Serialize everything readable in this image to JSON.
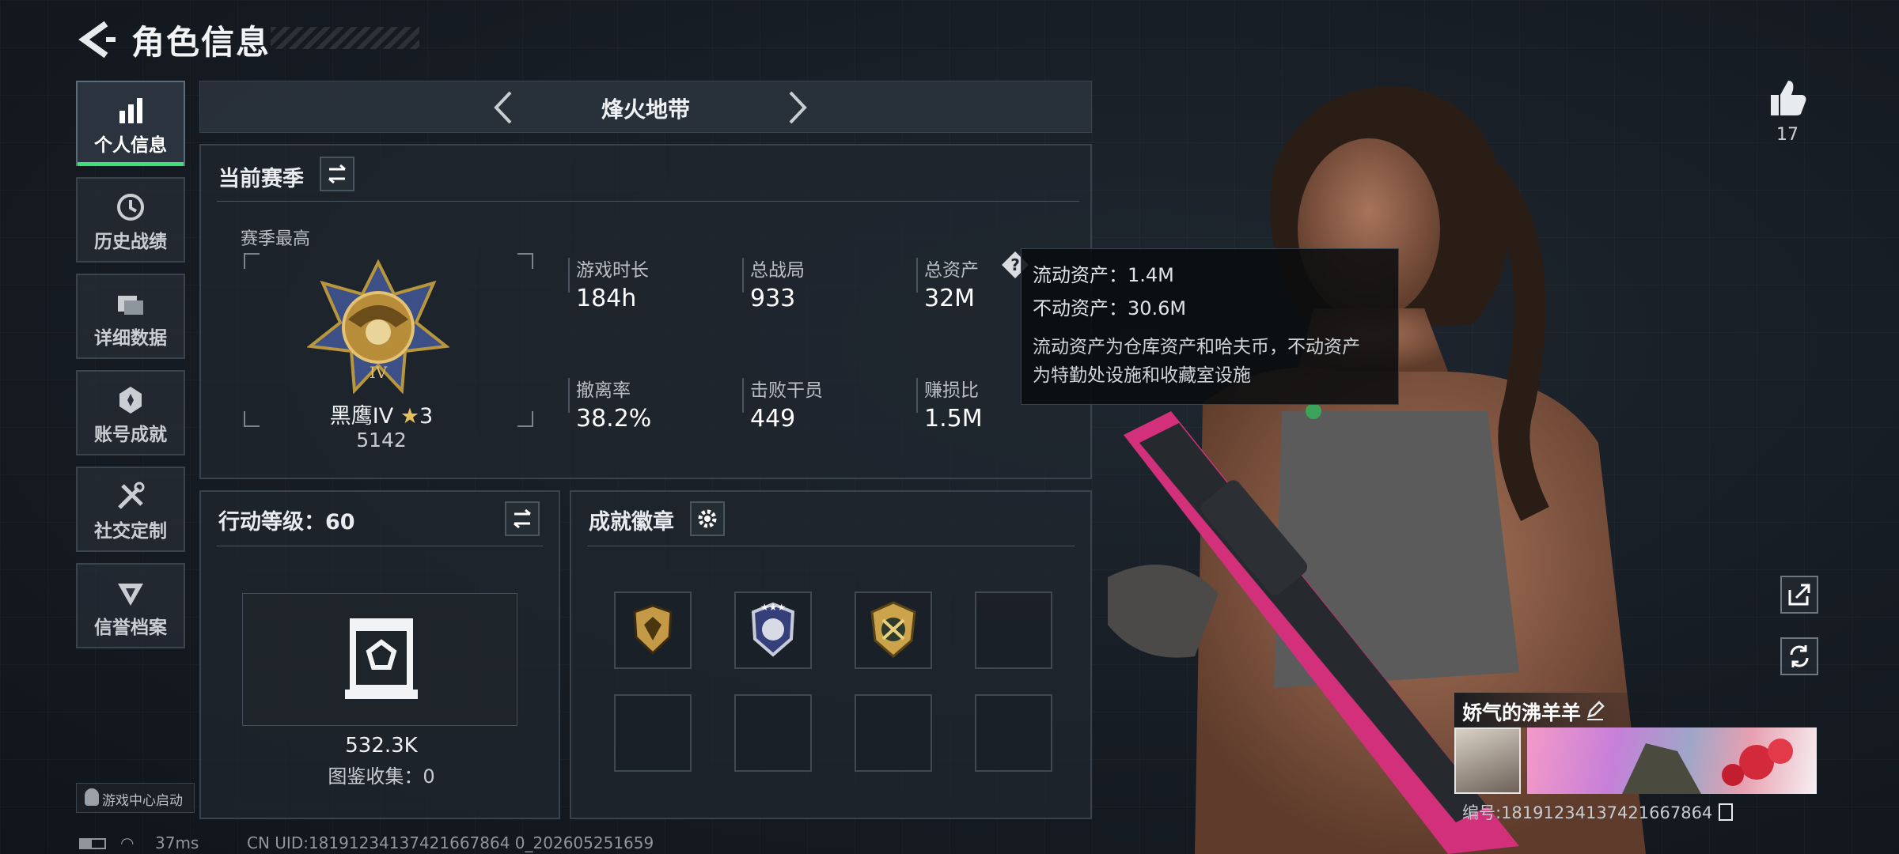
{
  "header": {
    "title": "角色信息"
  },
  "nav": [
    {
      "label": "个人信息",
      "icon": "bar-chart-icon",
      "active": true
    },
    {
      "label": "历史战绩",
      "icon": "clock-icon"
    },
    {
      "label": "详细数据",
      "icon": "cards-icon"
    },
    {
      "label": "账号成就",
      "icon": "achievement-icon"
    },
    {
      "label": "社交定制",
      "icon": "tools-icon"
    },
    {
      "label": "信誉档案",
      "icon": "reputation-icon"
    }
  ],
  "mode": {
    "title": "烽火地带"
  },
  "season": {
    "title": "当前赛季",
    "best_label": "赛季最高",
    "rank_name": "黑鹰IV",
    "rank_stars": "3",
    "rank_points": "5142",
    "stats": [
      {
        "label": "游戏时长",
        "value": "184h"
      },
      {
        "label": "总战局",
        "value": "933"
      },
      {
        "label": "总资产",
        "value": "32M"
      },
      {
        "label": "撤离率",
        "value": "38.2%"
      },
      {
        "label": "击败干员",
        "value": "449"
      },
      {
        "label": "赚损比",
        "value": "1.5M"
      }
    ]
  },
  "tooltip": {
    "liquid": "流动资产：1.4M",
    "fixed": "不动资产：30.6M",
    "note_line1": "流动资产为仓库资产和哈夫币，不动资产",
    "note_line2": "为特勤处设施和收藏室设施"
  },
  "action_level": {
    "title": "行动等级：60",
    "value": "532.3K",
    "collection": "图鉴收集：0"
  },
  "achievements": {
    "title": "成就徽章",
    "badges": [
      "shield-badge-gold",
      "shield-badge-blue",
      "shield-badge-gold-crest",
      "",
      "",
      "",
      "",
      ""
    ]
  },
  "likes": {
    "count": "17"
  },
  "profile": {
    "name": "娇气的沸羊羊",
    "id_text": "编号:18191234137421667864"
  },
  "footer": {
    "game_center": "游戏中心启动",
    "ping": "37ms",
    "uid": "CN UID:18191234137421667864 0_202605251659"
  },
  "colors": {
    "accent": "#3ee07a",
    "panel": "#20272f",
    "border": "#39434e"
  }
}
